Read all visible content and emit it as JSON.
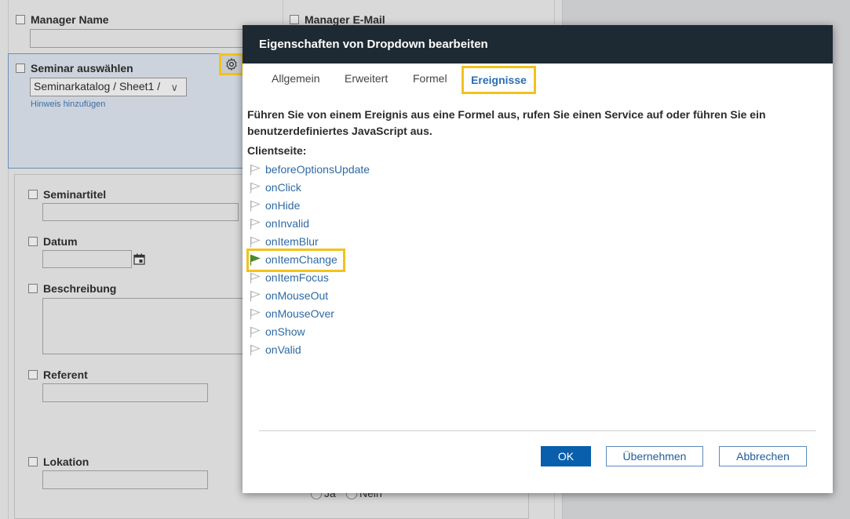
{
  "form": {
    "manager_name_label": "Manager Name",
    "manager_email_label": "Manager E-Mail",
    "seminar_select_label": "Seminar auswählen",
    "seminar_dropdown_value": "Seminarkatalog / Sheet1 /",
    "hint_link": "Hinweis hinzufügen",
    "seminar_title_label": "Seminartitel",
    "date_label": "Datum",
    "description_label": "Beschreibung",
    "speaker_label": "Referent",
    "location_label": "Lokation",
    "radio_yes": "Ja",
    "radio_no": "Nein"
  },
  "modal": {
    "title": "Eigenschaften von Dropdown bearbeiten",
    "tabs": [
      "Allgemein",
      "Erweitert",
      "Formel",
      "Ereignisse"
    ],
    "active_tab": "Ereignisse",
    "description": "Führen Sie von einem Ereignis aus eine Formel aus, rufen Sie einen Service auf oder führen Sie ein benutzerdefiniertes JavaScript aus.",
    "client_side_label": "Clientseite:",
    "events": [
      "beforeOptionsUpdate",
      "onClick",
      "onHide",
      "onInvalid",
      "onItemBlur",
      "onItemChange",
      "onItemFocus",
      "onMouseOut",
      "onMouseOver",
      "onShow",
      "onValid"
    ],
    "active_event": "onItemChange",
    "buttons": {
      "ok": "OK",
      "apply": "Übernehmen",
      "cancel": "Abbrechen"
    }
  },
  "colors": {
    "highlight": "#f2c21b",
    "header_bg": "#1e2a33",
    "link": "#2e6aa3",
    "primary_button": "#0a5fad",
    "active_flag": "#4a8a2a"
  },
  "icons": {
    "settings": "gear-icon",
    "calendar": "calendar-icon",
    "event_flag": "flag-icon"
  }
}
